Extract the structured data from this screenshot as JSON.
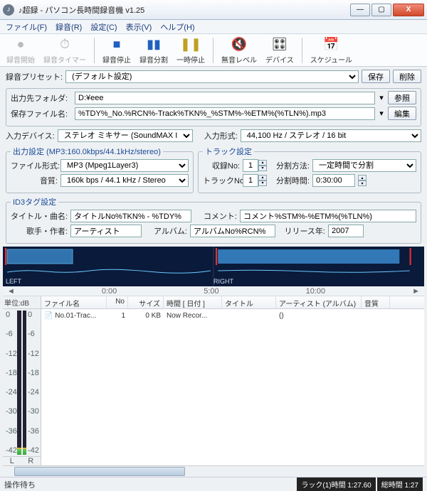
{
  "window": {
    "title": "♪超録 - パソコン長時間録音機 v1.25"
  },
  "winbtns": {
    "min": "—",
    "max": "▢",
    "close": "X"
  },
  "menu": [
    "ファイル(F)",
    "録音(R)",
    "設定(C)",
    "表示(V)",
    "ヘルプ(H)"
  ],
  "toolbar": [
    {
      "label": "録音開始",
      "icon": "●",
      "color": "#c02020",
      "disabled": true
    },
    {
      "label": "録音タイマー",
      "icon": "⏱",
      "color": "#c02020",
      "disabled": true
    },
    {
      "label": "録音停止",
      "icon": "■",
      "color": "#2060c0"
    },
    {
      "label": "録音分割",
      "icon": "▮▮",
      "color": "#2060c0"
    },
    {
      "label": "一時停止",
      "icon": "❚❚",
      "color": "#c0a020"
    },
    {
      "label": "無音レベル",
      "icon": "🔇",
      "color": "#333"
    },
    {
      "label": "デバイス",
      "icon": "🎛",
      "color": "#333"
    },
    {
      "label": "スケジュール",
      "icon": "📅",
      "color": "#333"
    }
  ],
  "preset": {
    "label": "録音プリセット:",
    "value": "(デフォルト設定)",
    "save": "保存",
    "del": "削除"
  },
  "output": {
    "folder_label": "出力先フォルダ:",
    "folder": "D:¥eee",
    "browse": "参照",
    "file_label": "保存ファイル名:",
    "file": "%TDY%_No.%RCN%-Track%TKN%_%STM%-%ETM%(%TLN%).mp3",
    "edit": "編集"
  },
  "devices": {
    "in_label": "入力デバイス:",
    "in": "ステレオ ミキサー (SoundMAX Int",
    "fmt_label": "入力形式:",
    "fmt": "44,100 Hz / ステレオ / 16 bit"
  },
  "out_settings": {
    "legend": "出力設定 (MP3:160.0kbps/44.1kHz/stereo)",
    "filetype_label": "ファイル形式:",
    "filetype": "MP3 (Mpeg1Layer3)",
    "quality_label": "音質:",
    "quality": "160k bps / 44.1 kHz / Stereo"
  },
  "track_settings": {
    "legend": "トラック設定",
    "recno_label": "収録No:",
    "recno": "1",
    "trackno_label": "トラックNo:",
    "trackno": "1",
    "split_label": "分割方法:",
    "split": "一定時間で分割",
    "splittime_label": "分割時間:",
    "splittime": "0:30:00"
  },
  "id3": {
    "legend": "ID3タグ設定",
    "title_label": "タイトル・曲名:",
    "title": "タイトルNo%TKN% - %TDY%",
    "comment_label": "コメント:",
    "comment": "コメント%STM%-%ETM%(%TLN%)",
    "artist_label": "歌手・作者:",
    "artist": "アーティスト",
    "album_label": "アルバム:",
    "album": "アルバムNo%RCN%",
    "year_label": "リリース年:",
    "year": "2007"
  },
  "waveform": {
    "left": "LEFT",
    "right": "RIGHT"
  },
  "timeline": {
    "t0": "0:00",
    "t1": "5:00",
    "t2": "10:00",
    "arrow_l": "◄",
    "arrow_r": "►"
  },
  "meter": {
    "header": "単位:dB",
    "scale": [
      "0",
      "-6",
      "-12",
      "-18",
      "-24",
      "-30",
      "-36",
      "-42"
    ],
    "L": "L",
    "R": "R"
  },
  "columns": {
    "name": "ファイル名",
    "no": "No",
    "size": "サイズ",
    "time": "時間 [ 日付 ]",
    "title": "タイトル",
    "artist": "アーティスト (アルバム)",
    "q": "音質"
  },
  "files": [
    {
      "name": "No.01-Trac...",
      "no": "1",
      "size": "0 KB",
      "time": "Now Recor...",
      "title": "",
      "artist": "()",
      "q": ""
    }
  ],
  "status": {
    "left": "操作待ち",
    "track": "ラック(1)時間 1:27.60",
    "total": "総時間 1:27"
  }
}
